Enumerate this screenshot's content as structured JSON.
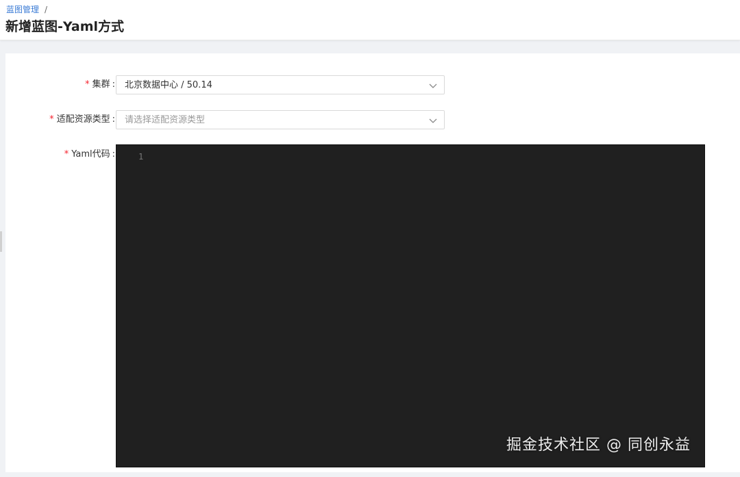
{
  "breadcrumb": {
    "items": [
      {
        "label": "蓝图管理"
      }
    ],
    "separator": "/"
  },
  "page": {
    "title": "新增蓝图-Yaml方式"
  },
  "form": {
    "cluster": {
      "required_mark": "*",
      "label": "集群",
      "colon": ":",
      "value": "北京数据中心 / 50.14"
    },
    "resource_type": {
      "required_mark": "*",
      "label": "适配资源类型",
      "colon": ":",
      "placeholder": "请选择适配资源类型"
    },
    "yaml_code": {
      "required_mark": "*",
      "label": "Yaml代码",
      "colon": ":",
      "line_numbers": [
        "1"
      ]
    }
  },
  "watermark": {
    "text": "掘金技术社区 @ 同创永益"
  },
  "colors": {
    "link": "#3a7bd5",
    "required": "#f5222d",
    "editor_bg": "#202020"
  }
}
